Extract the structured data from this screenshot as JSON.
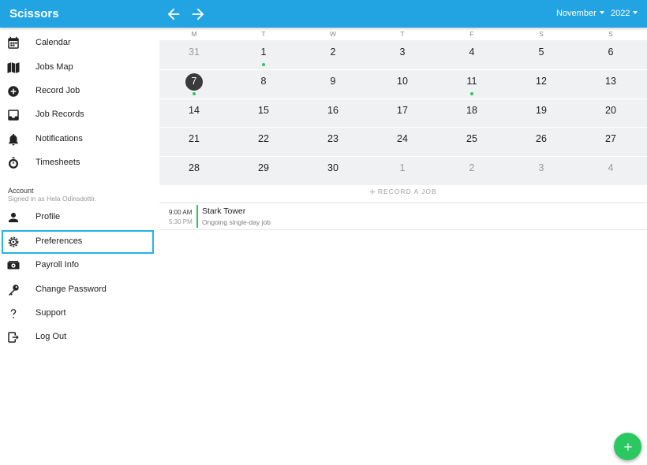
{
  "app": {
    "title": "Scissors"
  },
  "header": {
    "month": "November",
    "year": "2022"
  },
  "sidebar": {
    "items": [
      {
        "label": "Calendar",
        "icon": "calendar-icon"
      },
      {
        "label": "Jobs Map",
        "icon": "map-icon"
      },
      {
        "label": "Record Job",
        "icon": "plus-circle-icon"
      },
      {
        "label": "Job Records",
        "icon": "inbox-icon"
      },
      {
        "label": "Notifications",
        "icon": "bell-icon"
      },
      {
        "label": "Timesheets",
        "icon": "stopwatch-icon"
      }
    ],
    "account": {
      "title": "Account",
      "subtitle": "Signed in as Hela Odinsdottir.",
      "items": [
        {
          "label": "Profile",
          "icon": "person-icon"
        },
        {
          "label": "Preferences",
          "icon": "gear-icon",
          "active": true
        },
        {
          "label": "Payroll Info",
          "icon": "money-icon"
        },
        {
          "label": "Change Password",
          "icon": "key-icon"
        },
        {
          "label": "Support",
          "icon": "question-icon"
        },
        {
          "label": "Log Out",
          "icon": "logout-icon"
        }
      ]
    }
  },
  "calendar": {
    "weekdays": [
      "M",
      "T",
      "W",
      "T",
      "F",
      "S",
      "S"
    ],
    "weeks": [
      [
        {
          "d": "31",
          "muted": true
        },
        {
          "d": "1",
          "dot": true
        },
        {
          "d": "2"
        },
        {
          "d": "3"
        },
        {
          "d": "4"
        },
        {
          "d": "5"
        },
        {
          "d": "6"
        }
      ],
      [
        {
          "d": "7",
          "today": true,
          "dot": true
        },
        {
          "d": "8"
        },
        {
          "d": "9"
        },
        {
          "d": "10"
        },
        {
          "d": "11",
          "dot": true
        },
        {
          "d": "12"
        },
        {
          "d": "13"
        }
      ],
      [
        {
          "d": "14"
        },
        {
          "d": "15"
        },
        {
          "d": "16"
        },
        {
          "d": "17"
        },
        {
          "d": "18"
        },
        {
          "d": "19"
        },
        {
          "d": "20"
        }
      ],
      [
        {
          "d": "21"
        },
        {
          "d": "22"
        },
        {
          "d": "23"
        },
        {
          "d": "24"
        },
        {
          "d": "25"
        },
        {
          "d": "26"
        },
        {
          "d": "27"
        }
      ],
      [
        {
          "d": "28"
        },
        {
          "d": "29"
        },
        {
          "d": "30"
        },
        {
          "d": "1",
          "muted": true
        },
        {
          "d": "2",
          "muted": true
        },
        {
          "d": "3",
          "muted": true
        },
        {
          "d": "4",
          "muted": true
        }
      ]
    ]
  },
  "record": {
    "label": "RECORD A JOB"
  },
  "event": {
    "start": "9:00 AM",
    "end": "5:30 PM",
    "title": "Stark Tower",
    "subtitle": "Ongoing single-day job"
  },
  "colors": {
    "primary": "#22a3e2",
    "accent": "#2bc760",
    "today": "#3a3a3a"
  }
}
